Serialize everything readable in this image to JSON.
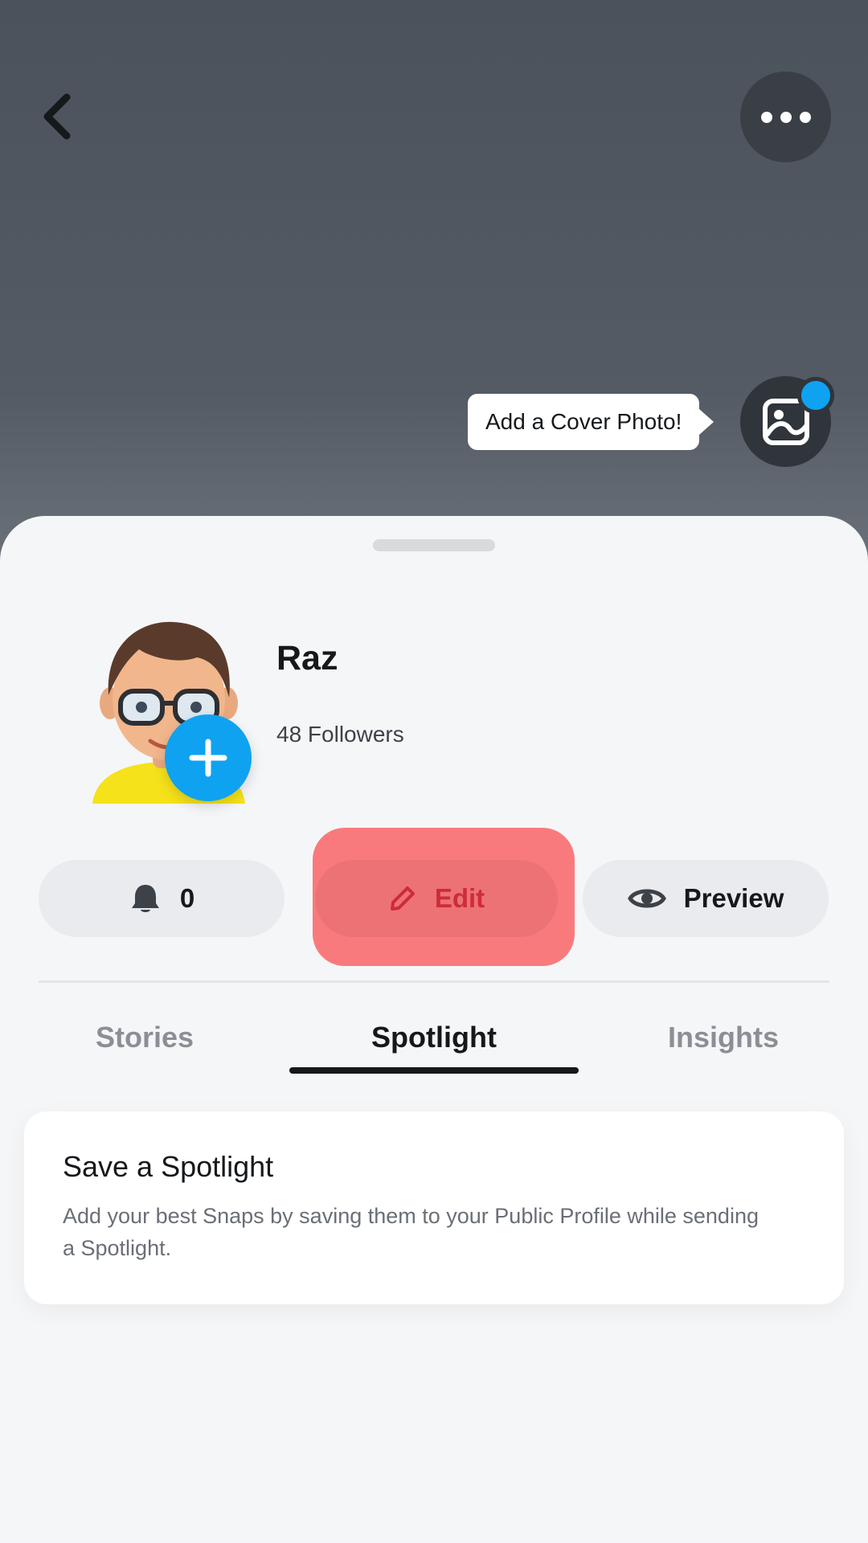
{
  "header": {
    "cover_tip": "Add a Cover Photo!"
  },
  "profile": {
    "name": "Raz",
    "followers": "48 Followers"
  },
  "actions": {
    "notify_count": "0",
    "edit_label": "Edit",
    "preview_label": "Preview"
  },
  "tabs": [
    {
      "label": "Stories",
      "active": false
    },
    {
      "label": "Spotlight",
      "active": true
    },
    {
      "label": "Insights",
      "active": false
    }
  ],
  "card": {
    "title": "Save a Spotlight",
    "body": "Add your best Snaps by saving them to your Public Profile while sending a Spotlight."
  },
  "icons": {
    "back": "chevron-left-icon",
    "more": "more-dots-icon",
    "cover": "image-icon",
    "add": "plus-icon",
    "notify": "bell-icon",
    "edit": "pencil-icon",
    "preview": "eye-icon"
  },
  "colors": {
    "accent_blue": "#0fa2f1",
    "edit_highlight": "#f97a7c",
    "edit_text": "#cc2d38",
    "header_bg": "#4b525b"
  }
}
